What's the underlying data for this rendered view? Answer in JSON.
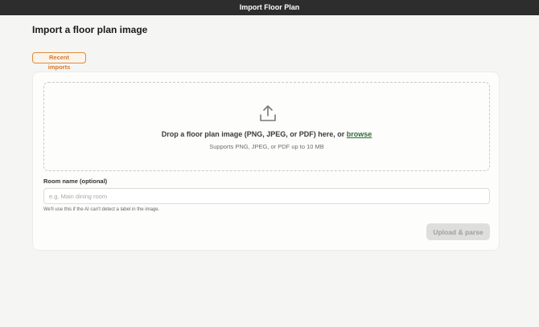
{
  "window": {
    "title": "Import Floor Plan"
  },
  "page": {
    "title": "Import a floor plan image"
  },
  "recent_imports_label": "Recent imports",
  "dropzone": {
    "main_text": "Drop a floor plan image (PNG, JPEG, or PDF) here, or",
    "browse_label": "browse",
    "sub_text": "Supports PNG, JPEG, or PDF up to 10 MB",
    "icon": "upload-icon"
  },
  "room_field": {
    "label": "Room name (optional)",
    "placeholder": "e.g. Main dining room",
    "value": "",
    "hint": "We'll use this if the AI can't detect a label in the image."
  },
  "submit": {
    "label": "Upload & parse",
    "enabled": false
  },
  "colors": {
    "titlebar_bg": "#2d2d2d",
    "accent_orange": "#e08a3a",
    "link_green": "#2f6b35",
    "disabled_button_bg": "#dededc"
  }
}
